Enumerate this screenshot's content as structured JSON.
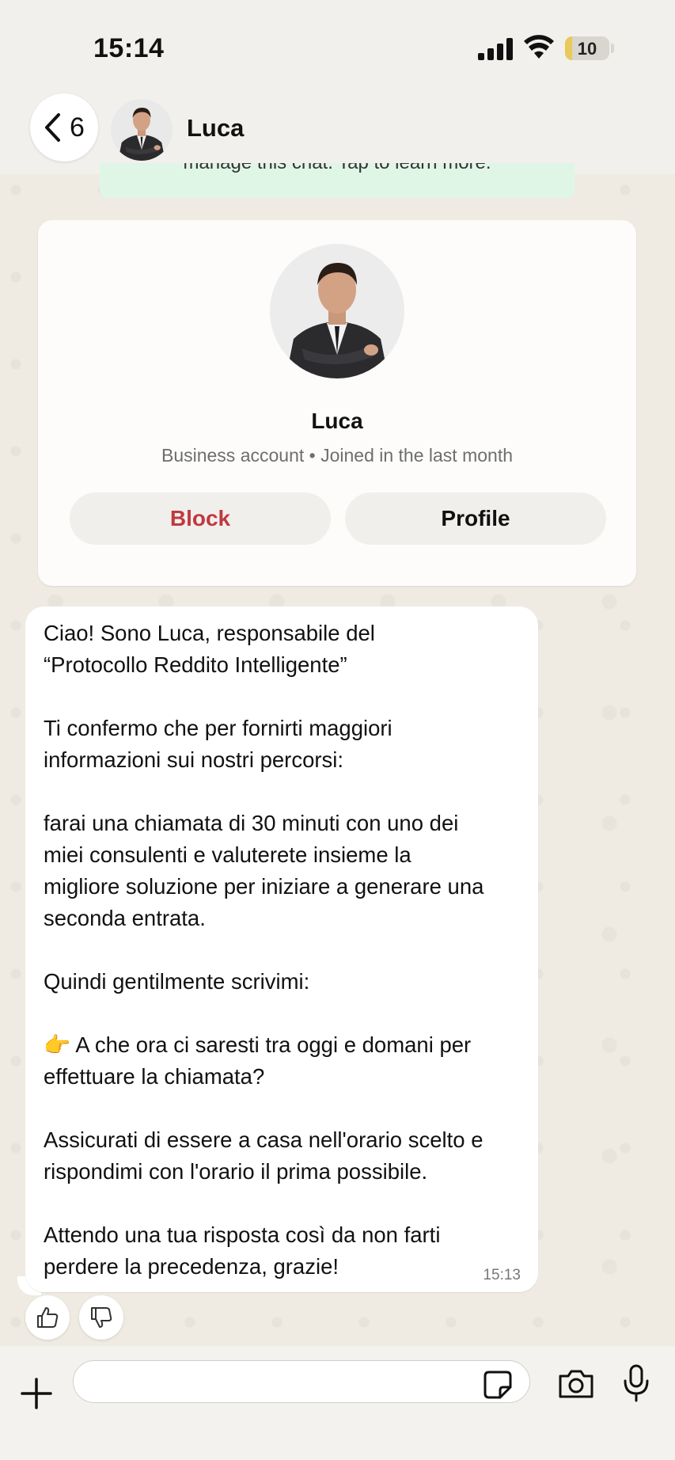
{
  "status": {
    "time": "15:14",
    "battery_level": "10",
    "battery_fraction": 0.1,
    "battery_color": "#e9c95a"
  },
  "header": {
    "back_count": "6",
    "contact_name": "Luca"
  },
  "banner": {
    "text": "manage this chat. Tap to learn more."
  },
  "profile_card": {
    "name": "Luca",
    "subtitle": "Business account • Joined in the last month",
    "block_label": "Block",
    "profile_label": "Profile",
    "block_color": "#c0393f"
  },
  "message": {
    "lines": [
      "Ciao! Sono Luca, responsabile del",
      "“Protocollo Reddito Intelligente”",
      "",
      "Ti confermo che per fornirti maggiori",
      "informazioni sui nostri percorsi:",
      "",
      "farai una chiamata di 30 minuti con uno dei",
      "miei consulenti e valuterete insieme la",
      "migliore soluzione per iniziare a generare una",
      "seconda entrata.",
      "",
      "Quindi gentilmente scrivimi:",
      "",
      "👉 A che ora ci saresti tra oggi e domani per",
      "effettuare la chiamata?",
      "",
      "Assicurati di essere a casa nell'orario scelto e",
      "rispondimi con l'orario il prima possibile.",
      "",
      "Attendo una tua risposta così da non farti",
      "perdere la precedenza, grazie!"
    ],
    "time": "15:13"
  },
  "icons": {
    "back": "chevron-left-icon",
    "thumbs_up": "thumbs-up-icon",
    "thumbs_down": "thumbs-down-icon",
    "attach": "plus-icon",
    "sticker": "sticker-icon",
    "camera": "camera-icon",
    "mic": "microphone-icon"
  }
}
